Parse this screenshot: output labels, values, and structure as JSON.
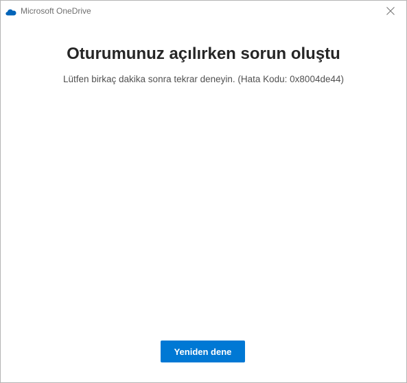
{
  "window": {
    "title": "Microsoft OneDrive",
    "app_icon": "onedrive-cloud-icon",
    "close_icon": "close-icon"
  },
  "main": {
    "heading": "Oturumunuz açılırken sorun oluştu",
    "message": "Lütfen birkaç dakika sonra tekrar deneyin. (Hata Kodu: 0x8004de44)",
    "retry_label": "Yeniden dene"
  },
  "colors": {
    "accent": "#0078d4",
    "heading_text": "#262626",
    "body_text": "#505050"
  }
}
